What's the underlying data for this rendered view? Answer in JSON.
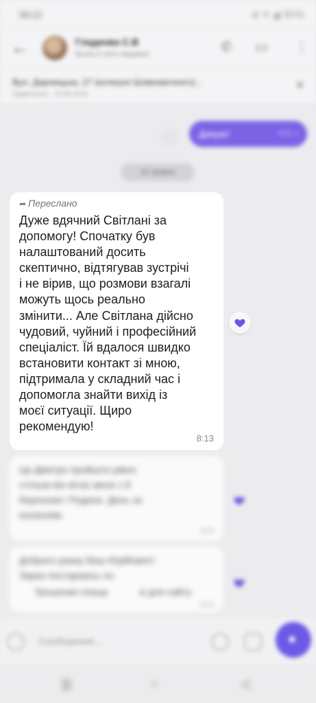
{
  "status_bar": {
    "time": "08:13",
    "indicators": "◎ ▾ ◢ 80%"
  },
  "header": {
    "contact_name": "Гладкова С.В",
    "contact_status": "Была в сети недавно",
    "back_icon": "arrow-left-icon",
    "call_icon": "phone-icon",
    "video_icon": "video-camera-icon",
    "menu_icon": "kebab-menu-icon"
  },
  "pinned": {
    "title": "Вул. Дарницька, 27 (колишні Шовковичного)...",
    "subtitle": "Закріплено · 15.05.2024",
    "close_icon": "close-icon"
  },
  "outgoing": {
    "text": "Дякую!",
    "time": "8:11",
    "status_icon": "double-check-icon"
  },
  "date_chip": "15 травня",
  "message": {
    "forwarded_label": "Переслано",
    "text": "Дуже вдячний Світлані за\nдопомогу! Спочатку був\nналаштований досить\nскептично, відтягував зустрічі\nі не вірив, що розмови взагалі\nможуть щось реально\nзмінити... Але Світлана дійсно\nчудовий, чуйний і професійний\nспеціаліст. Їй вдалося швидко\nвстановити контакт зі мною,\nпідтримала у складний час і\nдопомогла знайти вихід із\nмоєї ситуації. Щиро\nрекомендую!",
    "time": "8:13",
    "reaction_icon": "heart-icon"
  },
  "next_messages": [
    {
      "lines": [
        "Це Дмитро пройшло рівно",
        "стільки він вітає мене з 8",
        "березнем і Родини. День за",
        "коханням."
      ],
      "time": "8:14"
    },
    {
      "lines": [
        "Доброго ранку Ваш Юрійович!",
        "Зараз постараюсь по",
        "Трошечки спешу"
      ],
      "suffix": "в для сайту",
      "time": "8:15"
    }
  ],
  "input": {
    "placeholder": "Сообщение...",
    "emoji_icon": "smile-icon",
    "attach_icon": "paperclip-icon",
    "camera_icon": "camera-icon",
    "send_icon": "microphone-icon"
  },
  "nav": {
    "back": "◁",
    "home": "○",
    "recents": "|||"
  },
  "colors": {
    "accent": "#7b63e6",
    "send": "#6b5ae6",
    "background": "#ececee",
    "bubble": "#ffffff",
    "heart": "#6b55e0"
  }
}
